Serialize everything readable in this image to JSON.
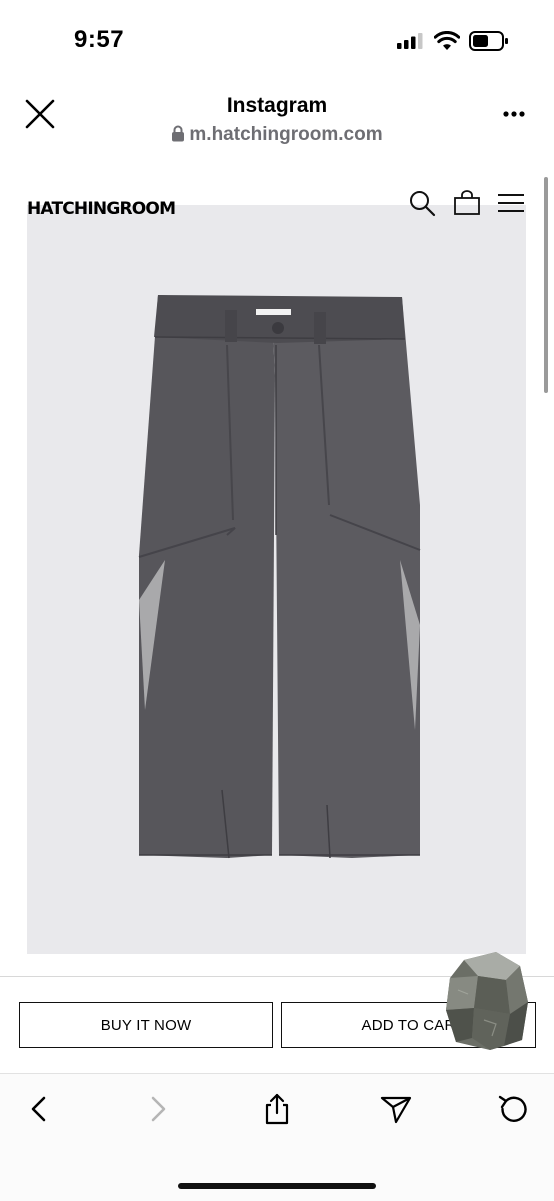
{
  "status_bar": {
    "time": "9:57"
  },
  "header": {
    "title": "Instagram",
    "url": "m.hatchingroom.com"
  },
  "site": {
    "logo": "HATCHINGROOM"
  },
  "product": {
    "buy_now_label": "BUY IT NOW",
    "add_to_cart_label": "ADD TO CAR"
  },
  "icons": {
    "close": "close-icon",
    "more": "more-icon",
    "lock": "lock-icon",
    "search": "search-icon",
    "bag": "shopping-bag-icon",
    "menu": "hamburger-menu-icon",
    "back": "chevron-left-icon",
    "forward": "chevron-right-icon",
    "share": "share-icon",
    "send": "send-icon",
    "reload": "reload-icon"
  },
  "colors": {
    "pants": "#55545a",
    "image_bg": "#e9e9ec",
    "url_gray": "#6e6e73",
    "forward_disabled": "#b5b5b5"
  }
}
